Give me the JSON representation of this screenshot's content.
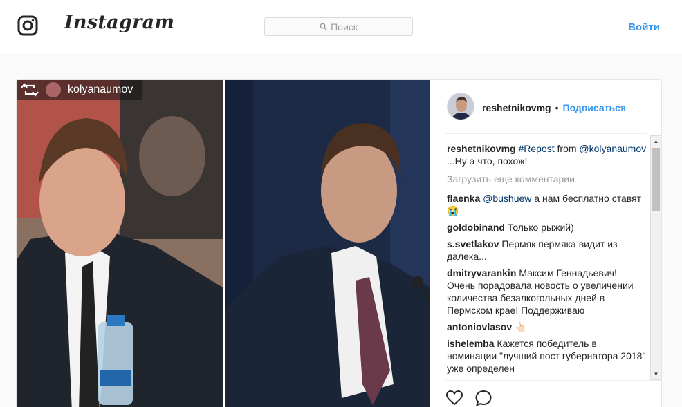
{
  "header": {
    "brand": "Instagram",
    "search_placeholder": "Поиск",
    "login_label": "Войти"
  },
  "post": {
    "repost_from": "kolyanaumov",
    "author": "reshetnikovmg",
    "separator": "•",
    "follow_label": "Подписаться",
    "caption": {
      "user": "reshetnikovmg",
      "hashtag": "#Repost",
      "from_word": " from ",
      "mention": "@kolyanaumov",
      "text": " ...Ну а что, похож!"
    },
    "load_more_label": "Загрузить еще комментарии",
    "comments": [
      {
        "user": "flaenka",
        "mention": "@bushuew",
        "text": " а нам бесплатно ставят 😭"
      },
      {
        "user": "goldobinand",
        "mention": "",
        "text": " Только рыжий)"
      },
      {
        "user": "s.svetlakov",
        "mention": "",
        "text": " Пермяк пермяка видит из далека..."
      },
      {
        "user": "dmitryvarankin",
        "mention": "",
        "text": " Максим Геннадьевич! Очень порадовала новость о увеличении количества безалкогольных дней в Пермском крае! Поддерживаю"
      },
      {
        "user": "antoniovlasov",
        "mention": "",
        "text": " 👆🏻"
      },
      {
        "user": "ishelemba",
        "mention": "",
        "text": " Кажется победитель в номинации \"лучший пост губернатора 2018\" уже определен"
      }
    ]
  },
  "icons": {
    "logo": "instagram-camera-icon",
    "search": "search-icon",
    "repost": "repost-icon",
    "like": "heart-icon",
    "comment": "comment-icon"
  },
  "colors": {
    "accent": "#3897f0",
    "text": "#262626",
    "muted": "#999999",
    "link": "#003569"
  }
}
